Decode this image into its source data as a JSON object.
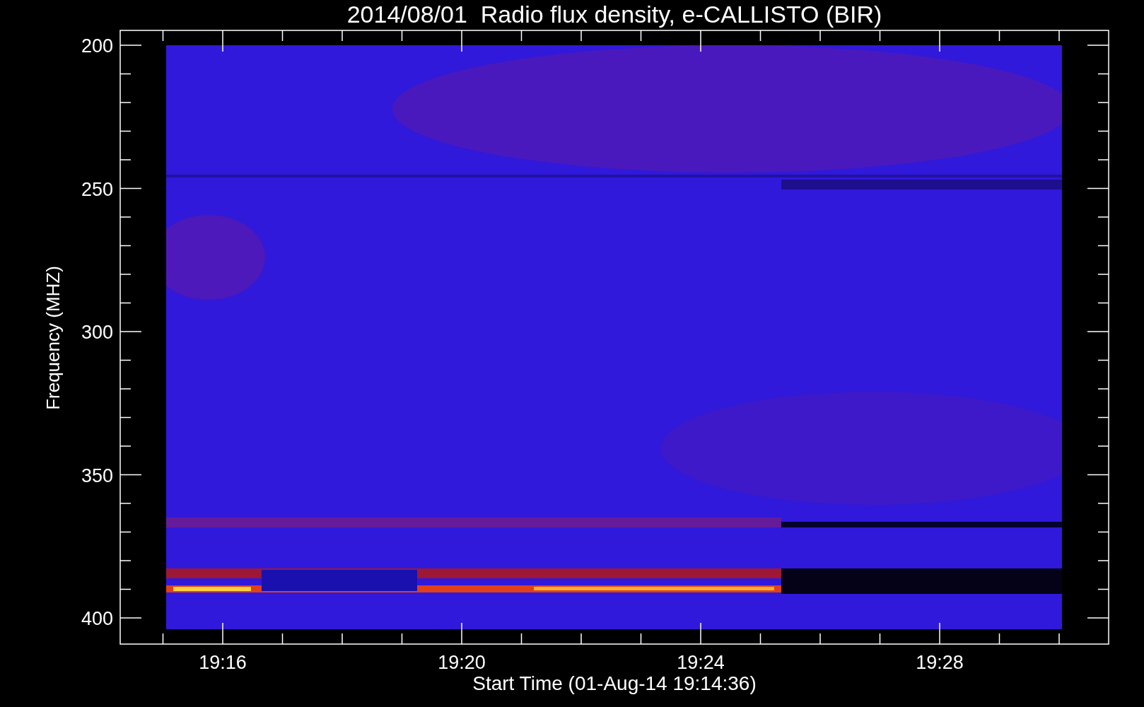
{
  "title": "2014/08/01  Radio flux density, e-CALLISTO (BIR)",
  "y_axis": {
    "label": "Frequency (MHZ)",
    "ticks": [
      "200",
      "250",
      "300",
      "350",
      "400"
    ]
  },
  "x_axis": {
    "label": "Start Time (01-Aug-14 19:14:36)",
    "ticks": [
      "19:16",
      "19:20",
      "19:24",
      "19:28"
    ]
  }
}
